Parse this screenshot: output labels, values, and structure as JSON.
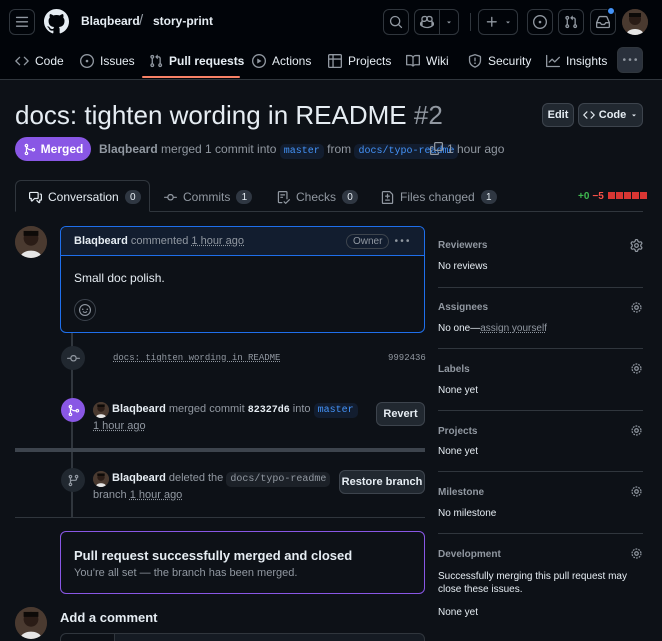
{
  "header": {
    "owner": "Blaqbeard",
    "separator": "/",
    "repo": "story-print",
    "nav_tabs": [
      {
        "label": "Code",
        "icon": "code-icon"
      },
      {
        "label": "Issues",
        "icon": "issue-opened-icon"
      },
      {
        "label": "Pull requests",
        "icon": "git-pull-request-icon"
      },
      {
        "label": "Actions",
        "icon": "play-icon"
      },
      {
        "label": "Projects",
        "icon": "table-icon"
      },
      {
        "label": "Wiki",
        "icon": "book-icon"
      },
      {
        "label": "Security",
        "icon": "shield-icon"
      },
      {
        "label": "Insights",
        "icon": "graph-icon"
      }
    ],
    "selected_tab": "Pull requests"
  },
  "pr": {
    "title": "docs: tighten wording in README",
    "number": "#2",
    "state": "Merged",
    "author": "Blaqbeard",
    "meta_merged": "merged 1 commit into",
    "base_branch": "master",
    "meta_from": "from",
    "head_branch": "docs/typo-readme",
    "time": "1 hour ago",
    "edit_label": "Edit",
    "code_label": "Code"
  },
  "pr_tabs": [
    {
      "label": "Conversation",
      "count": "0"
    },
    {
      "label": "Commits",
      "count": "1"
    },
    {
      "label": "Checks",
      "count": "0"
    },
    {
      "label": "Files changed",
      "count": "1"
    }
  ],
  "diffstat": {
    "additions": "+0",
    "deletions": "−5"
  },
  "comment": {
    "author": "Blaqbeard",
    "verb": "commented",
    "time": "1 hour ago",
    "badge": "Owner",
    "body": "Small doc polish."
  },
  "timeline": {
    "commit_message": "docs: tighten wording in README",
    "commit_sha": "9992436",
    "merge_actor": "Blaqbeard",
    "merge_text": "merged commit",
    "merge_sha": "82327d6",
    "merge_into": "into",
    "merge_branch": "master",
    "merge_time": "1 hour ago",
    "revert_label": "Revert",
    "delete_actor": "Blaqbeard",
    "delete_text": "deleted the",
    "delete_branch": "docs/typo-readme",
    "delete_suffix": "branch",
    "delete_time": "1 hour ago",
    "restore_label": "Restore branch"
  },
  "merged_box": {
    "title": "Pull request successfully merged and closed",
    "subtitle": "You’re all set — the branch has been merged."
  },
  "add_comment": "Add a comment",
  "sidebar": {
    "reviewers": {
      "label": "Reviewers",
      "value": "No reviews"
    },
    "assignees": {
      "label": "Assignees",
      "value": "No one—",
      "link": "assign yourself"
    },
    "labels": {
      "label": "Labels",
      "value": "None yet"
    },
    "projects": {
      "label": "Projects",
      "value": "None yet"
    },
    "milestone": {
      "label": "Milestone",
      "value": "No milestone"
    },
    "development": {
      "label": "Development",
      "text": "Successfully merging this pull request may close these issues.",
      "value": "None yet"
    }
  },
  "colors": {
    "merged": "#8957e5",
    "accent": "#f78166",
    "link": "#4493f8",
    "addition": "#3fb950",
    "deletion": "#f85149"
  }
}
